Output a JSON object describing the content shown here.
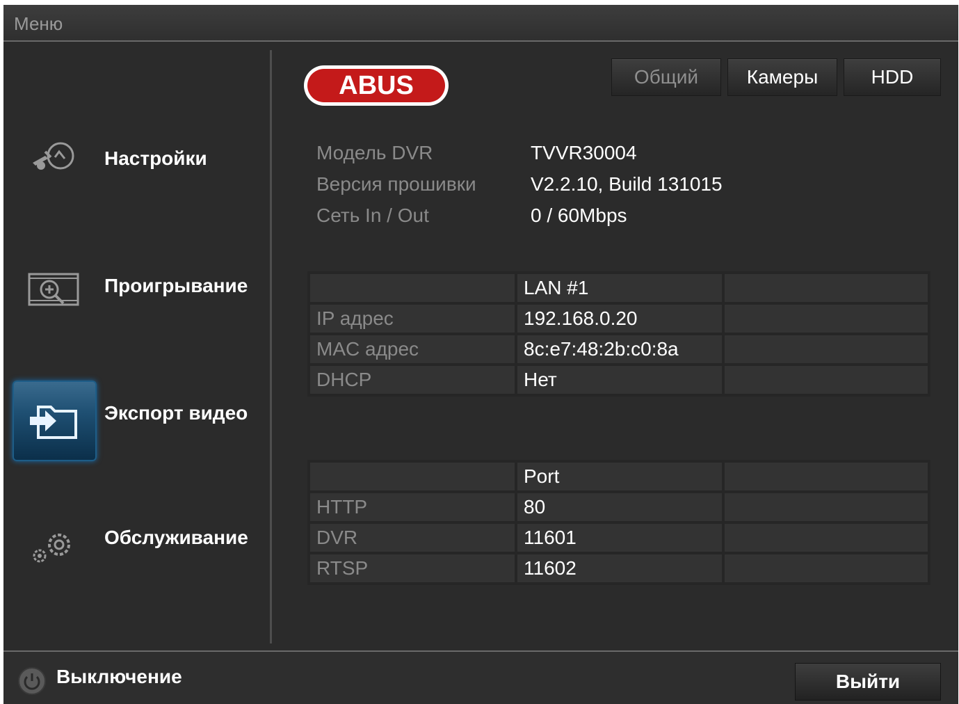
{
  "titlebar": {
    "title": "Меню"
  },
  "sidebar": {
    "items": [
      {
        "label": "Настройки",
        "icon": "settings-icon",
        "active": false
      },
      {
        "label": "Проигрывание",
        "icon": "playback-icon",
        "active": false
      },
      {
        "label": "Экспорт видео",
        "icon": "export-folder-icon",
        "active": true
      },
      {
        "label": "Обслуживание",
        "icon": "maintenance-gears-icon",
        "active": false
      }
    ]
  },
  "logo": {
    "text": "ABUS",
    "color": "#c41a1a"
  },
  "tabs": [
    {
      "label": "Общий",
      "active": true
    },
    {
      "label": "Камеры",
      "active": false
    },
    {
      "label": "HDD",
      "active": false
    }
  ],
  "info": [
    {
      "label": "Модель DVR",
      "value": "TVVR30004"
    },
    {
      "label": "Версия прошивки",
      "value": "V2.2.10, Build 131015"
    },
    {
      "label": "Сеть In / Out",
      "value": "0 / 60Mbps"
    }
  ],
  "lan_table": {
    "header": [
      "",
      "LAN #1",
      ""
    ],
    "rows": [
      [
        "IP адрес",
        "192.168.0.20",
        ""
      ],
      [
        "MAC адрес",
        "8c:e7:48:2b:c0:8a",
        ""
      ],
      [
        "DHCP",
        "Нет",
        ""
      ]
    ]
  },
  "port_table": {
    "header": [
      "",
      "Port",
      ""
    ],
    "rows": [
      [
        "HTTP",
        "80",
        ""
      ],
      [
        "DVR",
        "11601",
        ""
      ],
      [
        "RTSP",
        "11602",
        ""
      ]
    ]
  },
  "footer": {
    "power_label": "Выключение",
    "exit_label": "Выйти"
  },
  "colors": {
    "background": "#2b2b2b",
    "accent": "#1b6aa8",
    "label_gray": "#8a8a8a"
  }
}
